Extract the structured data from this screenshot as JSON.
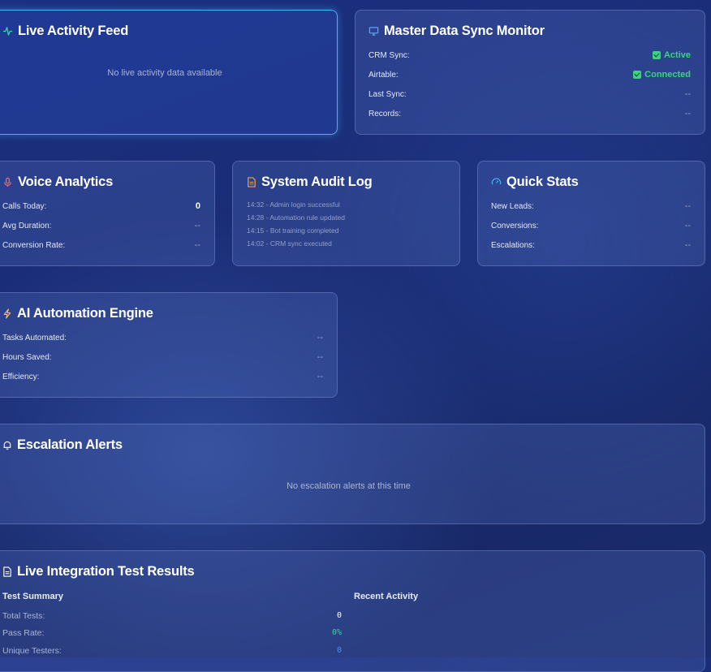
{
  "live_activity": {
    "title": "Live Activity Feed",
    "empty_text": "No live activity data available"
  },
  "master_sync": {
    "title": "Master Data Sync Monitor",
    "rows": [
      {
        "label": "CRM Sync:",
        "value": "Active",
        "status": "ok"
      },
      {
        "label": "Airtable:",
        "value": "Connected",
        "status": "ok"
      },
      {
        "label": "Last Sync:",
        "value": "--"
      },
      {
        "label": "Records:",
        "value": "--"
      }
    ]
  },
  "voice_analytics": {
    "title": "Voice Analytics",
    "rows": [
      {
        "label": "Calls Today:",
        "value": "0"
      },
      {
        "label": "Avg Duration:",
        "value": "--"
      },
      {
        "label": "Conversion Rate:",
        "value": "--"
      }
    ]
  },
  "audit_log": {
    "title": "System Audit Log",
    "entries": [
      "14:32 - Admin login successful",
      "14:28 - Automation rule updated",
      "14:15 - Bot training completed",
      "14:02 - CRM sync executed"
    ]
  },
  "quick_stats": {
    "title": "Quick Stats",
    "rows": [
      {
        "label": "New Leads:",
        "value": "--"
      },
      {
        "label": "Conversions:",
        "value": "--"
      },
      {
        "label": "Escalations:",
        "value": "--"
      }
    ]
  },
  "automation": {
    "title": "AI Automation Engine",
    "rows": [
      {
        "label": "Tasks Automated:",
        "value": "--"
      },
      {
        "label": "Hours Saved:",
        "value": "--"
      },
      {
        "label": "Efficiency:",
        "value": "--"
      }
    ]
  },
  "escalation": {
    "title": "Escalation Alerts",
    "empty_text": "No escalation alerts at this time"
  },
  "integration": {
    "title": "Live Integration Test Results",
    "summary_heading": "Test Summary",
    "recent_heading": "Recent Activity",
    "rows": [
      {
        "label": "Total Tests:",
        "value": "0"
      },
      {
        "label": "Pass Rate:",
        "value": "0%"
      },
      {
        "label": "Unique Testers:",
        "value": "0"
      }
    ]
  },
  "colors": {
    "accent_cyan": "#3fb8f0",
    "success_green": "#37d67a",
    "pass_rate_green": "#36d6a0",
    "testers_blue": "#4d8ff0",
    "mic_red": "#f06a7a",
    "doc_orange": "#f0a050",
    "bolt_yellow": "#f5c64a"
  },
  "icons": {
    "live_activity": "activity-pulse-icon",
    "master_sync": "monitor-icon",
    "voice_analytics": "microphone-icon",
    "audit_log": "document-icon",
    "quick_stats": "gauge-icon",
    "automation": "lightning-icon",
    "escalation": "bell-icon",
    "integration": "document-icon"
  }
}
